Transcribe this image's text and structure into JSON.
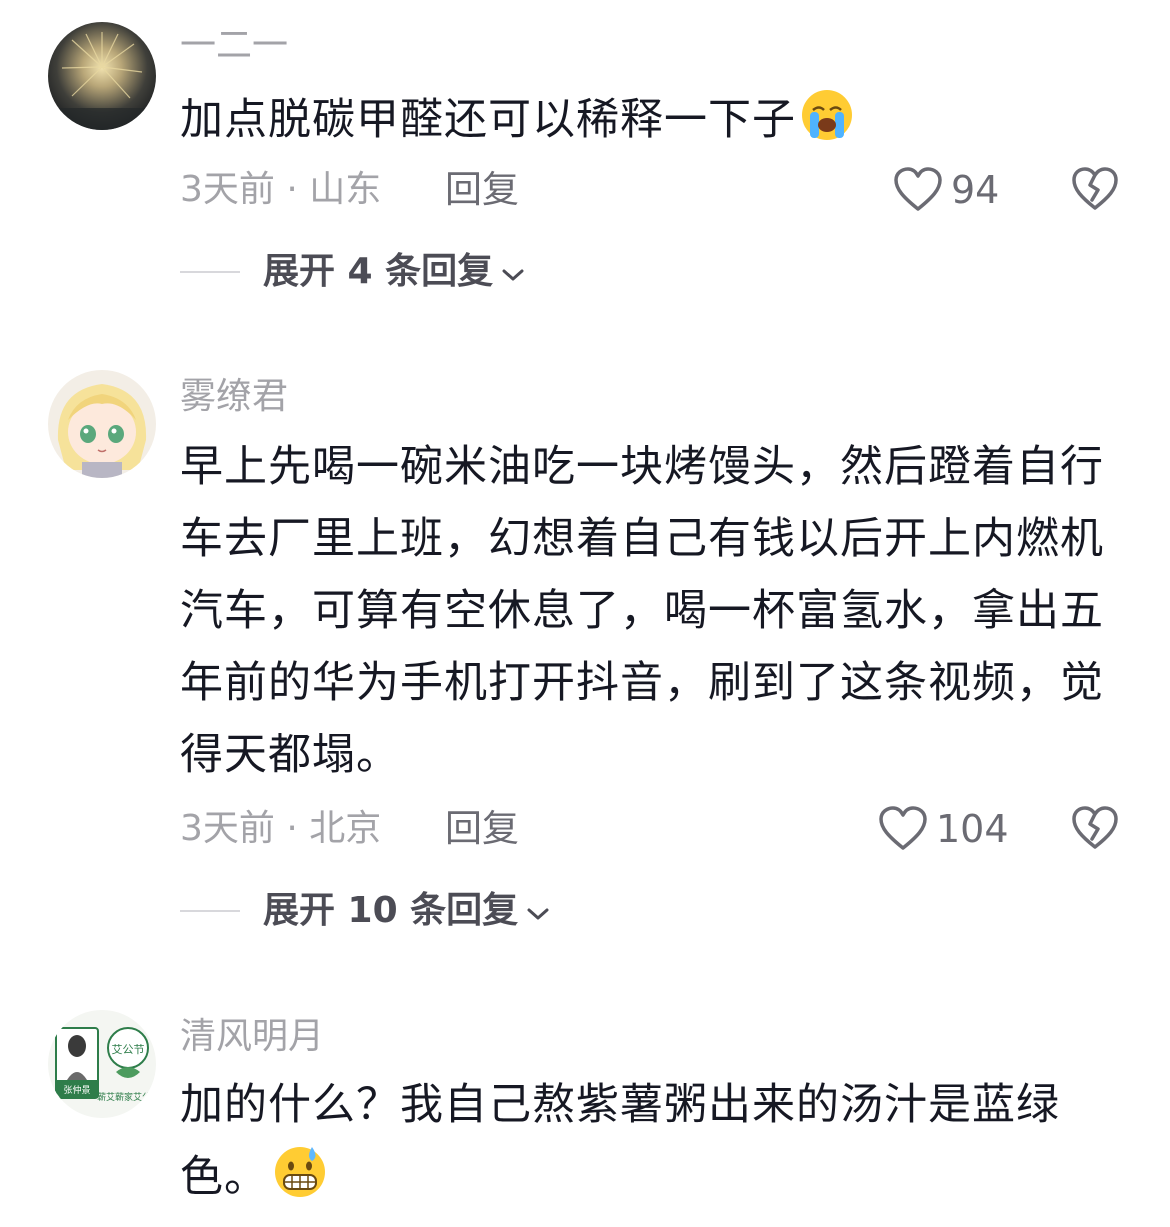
{
  "comments": [
    {
      "username": "一二一",
      "text": "加点脱碳甲醛还可以稀释一下子",
      "emoji": "loudly-crying-face-emoji",
      "time_location": "3天前 · 山东",
      "reply_label": "回复",
      "likes": "94",
      "expand_label": "展开 4 条回复"
    },
    {
      "username": "雾缭君",
      "text": "早上先喝一碗米油吃一块烤馒头，然后蹬着自行车去厂里上班，幻想着自己有钱以后开上内燃机汽车，可算有空休息了，喝一杯富氢水，拿出五年前的华为手机打开抖音，刷到了这条视频，觉得天都塌。",
      "time_location": "3天前 · 北京",
      "reply_label": "回复",
      "likes": "104",
      "expand_label": "展开 10 条回复"
    },
    {
      "username": "清风明月",
      "text": "加的什么？我自己熬紫薯粥出来的汤汁是蓝绿色。",
      "emoji": "grimacing-sweat-face-emoji",
      "avatar_text_left": "张仲景",
      "avatar_text_right": "艾公节",
      "avatar_caption": "蕲艾蕲家艾公"
    }
  ],
  "icons": {
    "like": "heart-outline-icon",
    "dislike": "broken-heart-icon",
    "expand": "chevron-down-icon"
  },
  "colors": {
    "text_primary": "#161823",
    "text_secondary": "#a3a3a8",
    "text_action": "#6b6b73",
    "background": "#ffffff"
  }
}
